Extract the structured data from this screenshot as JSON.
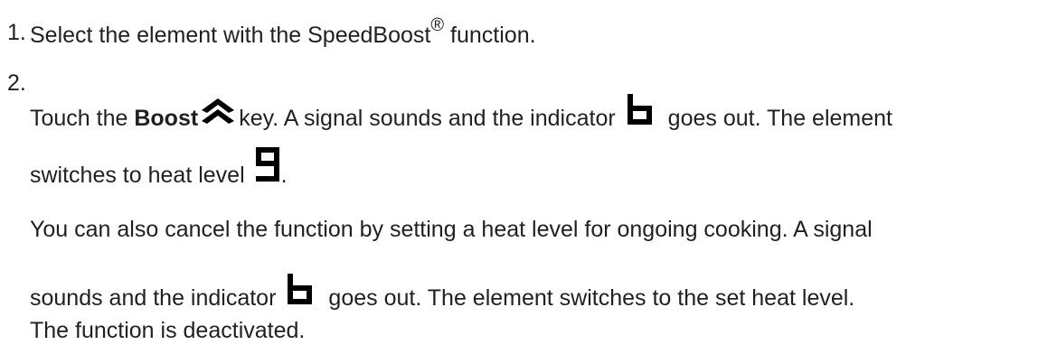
{
  "steps": [
    {
      "number": "1.",
      "text_before": "Select the element with the SpeedBoost",
      "superscript": "®",
      "text_after": " function."
    },
    {
      "number": "2.",
      "line1_before": "Touch the ",
      "boost_bold": "Boost",
      "line1_mid": "key. A signal sounds and the indicator",
      "line1_after": "goes out. The element",
      "line2_before": "switches to heat level",
      "line2_after": ".",
      "line3": "You can also cancel the function by setting a heat level for ongoing cooking. A signal",
      "line4_before": "sounds and the indicator",
      "line4_after": "goes out. The element switches to the set heat level.",
      "line5": "The function is deactivated."
    }
  ],
  "icons": {
    "boost_key": "double-chevron-up-icon",
    "indicator_b": "segment-b-indicator-icon",
    "heat_level_9": "segment-9-display-icon"
  },
  "colors": {
    "text": "#231f20",
    "icon": "#000000"
  }
}
